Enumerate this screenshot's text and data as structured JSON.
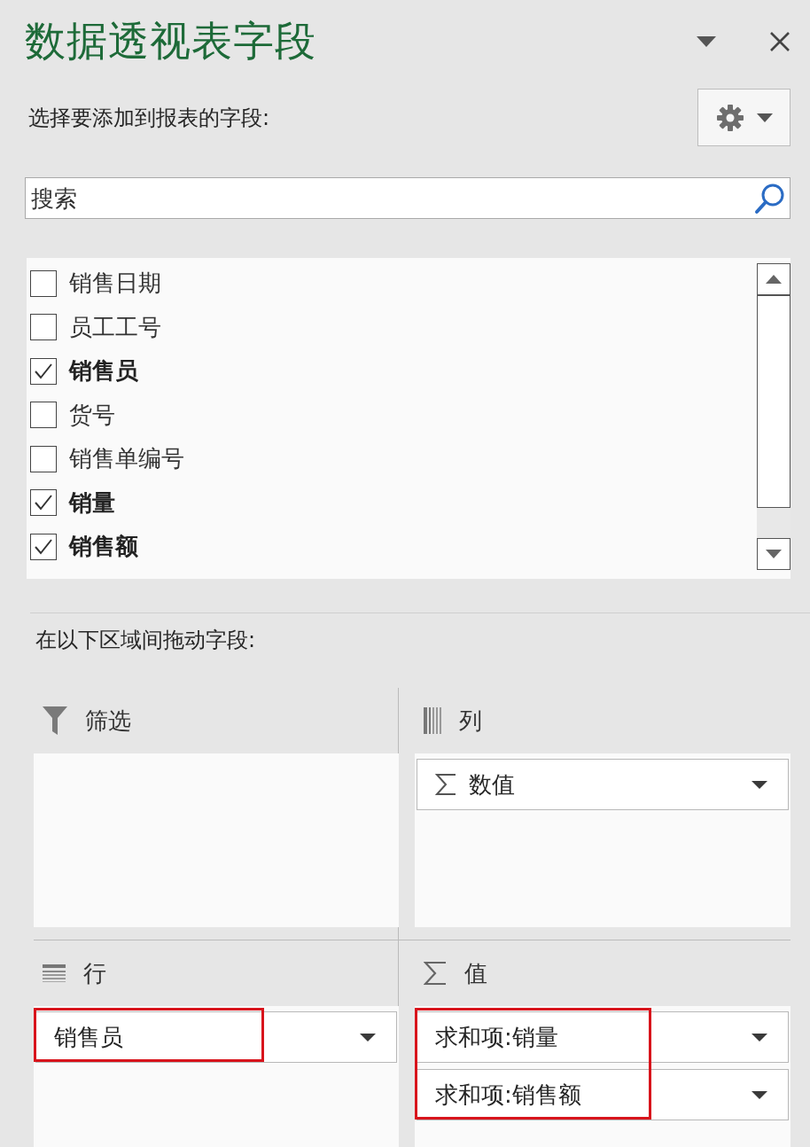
{
  "title": "数据透视表字段",
  "subtitle": "选择要添加到报表的字段:",
  "search": {
    "placeholder": "搜索"
  },
  "fields": [
    {
      "label": "销售日期",
      "checked": false
    },
    {
      "label": "员工工号",
      "checked": false
    },
    {
      "label": "销售员",
      "checked": true
    },
    {
      "label": "货号",
      "checked": false
    },
    {
      "label": "销售单编号",
      "checked": false
    },
    {
      "label": "销量",
      "checked": true
    },
    {
      "label": "销售额",
      "checked": true
    }
  ],
  "areas_label": "在以下区域间拖动字段:",
  "areas": [
    {
      "kind": "filters",
      "label": "筛选",
      "highlighted": false
    },
    {
      "kind": "columns",
      "label": "列",
      "highlighted": false,
      "items": [
        {
          "kind": "sigma",
          "label": "数值"
        }
      ]
    },
    {
      "kind": "rows",
      "label": "行",
      "highlighted": true,
      "items": [
        {
          "kind": "field",
          "label": "销售员"
        }
      ]
    },
    {
      "kind": "values",
      "label": "值",
      "highlighted": true,
      "items": [
        {
          "kind": "field",
          "label": "求和项:销量"
        },
        {
          "kind": "field",
          "label": "求和项:销售额"
        }
      ]
    }
  ]
}
